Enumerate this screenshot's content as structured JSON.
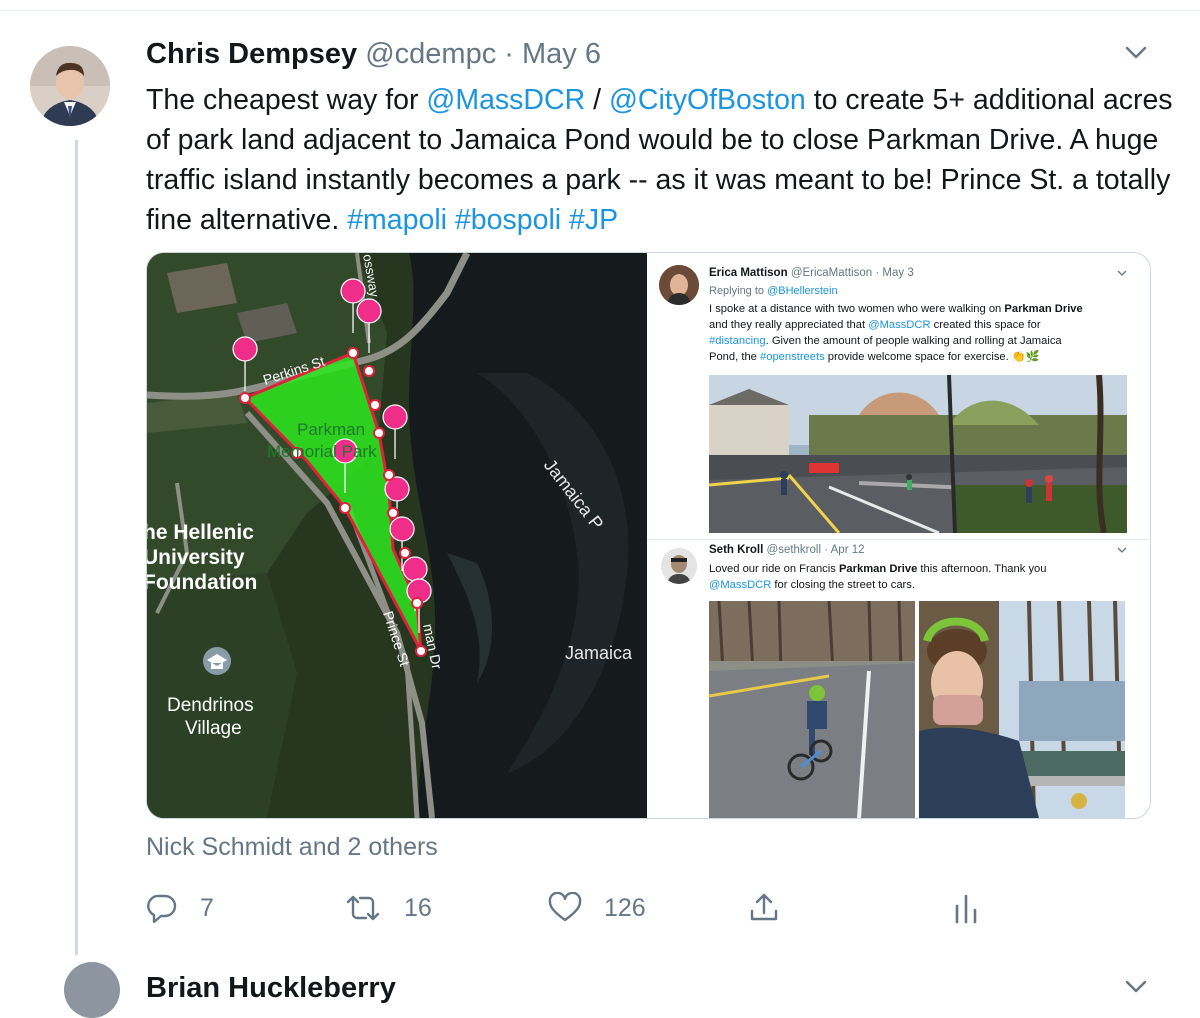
{
  "tweet": {
    "author_name": "Chris Dempsey",
    "handle": "@cdempc",
    "separator": "·",
    "date": "May 6",
    "text_parts": [
      {
        "t": "The cheapest way for ",
        "link": false
      },
      {
        "t": "@MassDCR",
        "link": true
      },
      {
        "t": " / ",
        "link": false
      },
      {
        "t": "@CityOfBoston",
        "link": true
      },
      {
        "t": " to create 5+ additional acres of park land adjacent to Jamaica Pond would be to close Parkman Drive. A huge traffic island instantly becomes a park -- as it was meant to be! Prince St. a totally fine alternative. ",
        "link": false
      },
      {
        "t": "#mapoli",
        "link": true
      },
      {
        "t": " ",
        "link": false
      },
      {
        "t": "#bospoli",
        "link": true
      },
      {
        "t": " ",
        "link": false
      },
      {
        "t": "#JP",
        "link": true
      }
    ],
    "liked_by": "Nick Schmidt and 2 others",
    "replies": "7",
    "retweets": "16",
    "likes": "126"
  },
  "map": {
    "labels": {
      "perkins": "Perkins St",
      "parkman_park_1": "Parkman",
      "parkman_park_2": "Memorial Park",
      "jamaica_pond": "Jamaica P",
      "jamaica_lower": "Jamaica",
      "hellenic_1": "he Hellenic",
      "hellenic_2": "University",
      "hellenic_3": "Foundation",
      "dendrinos_1": "Dendrinos",
      "dendrinos_2": "Village",
      "prince": "Prince St",
      "parkman_dr": "man Dr",
      "jamaicaway": "ossway"
    }
  },
  "embedded": {
    "t1": {
      "name": "Erica Mattison",
      "handle": "@EricaMattison",
      "sep": "·",
      "date": "May 3",
      "replying_prefix": "Replying to ",
      "replying_to": "@BHellerstein",
      "lines": [
        [
          {
            "t": "I spoke at a distance with two women who were walking on ",
            "s": ""
          },
          {
            "t": "Parkman Drive",
            "s": "b"
          }
        ],
        [
          {
            "t": "and they really appreciated that ",
            "s": ""
          },
          {
            "t": "@MassDCR",
            "s": "l"
          },
          {
            "t": " created this space for",
            "s": ""
          }
        ],
        [
          {
            "t": "#distancing",
            "s": "l"
          },
          {
            "t": ". Given the amount of people walking and rolling at Jamaica",
            "s": ""
          }
        ],
        [
          {
            "t": "Pond, the ",
            "s": ""
          },
          {
            "t": "#openstreets",
            "s": "l"
          },
          {
            "t": " provide welcome space for exercise. 👏🌿",
            "s": ""
          }
        ]
      ]
    },
    "t2": {
      "name": "Seth Kroll",
      "handle": "@sethkroll",
      "sep": "·",
      "date": "Apr 12",
      "lines": [
        [
          {
            "t": "Loved our ride on Francis ",
            "s": ""
          },
          {
            "t": "Parkman Drive",
            "s": "b"
          },
          {
            "t": " this afternoon. Thank you",
            "s": ""
          }
        ],
        [
          {
            "t": "@MassDCR",
            "s": "l"
          },
          {
            "t": " for closing the street to cars.",
            "s": ""
          }
        ]
      ]
    }
  },
  "next_tweet": {
    "author_name": "Brian Huckleberry"
  },
  "colors": {
    "link": "#1b95e0",
    "muted": "#657786",
    "park_fill": "#2ee81f",
    "pin": "#ef2e8a"
  }
}
